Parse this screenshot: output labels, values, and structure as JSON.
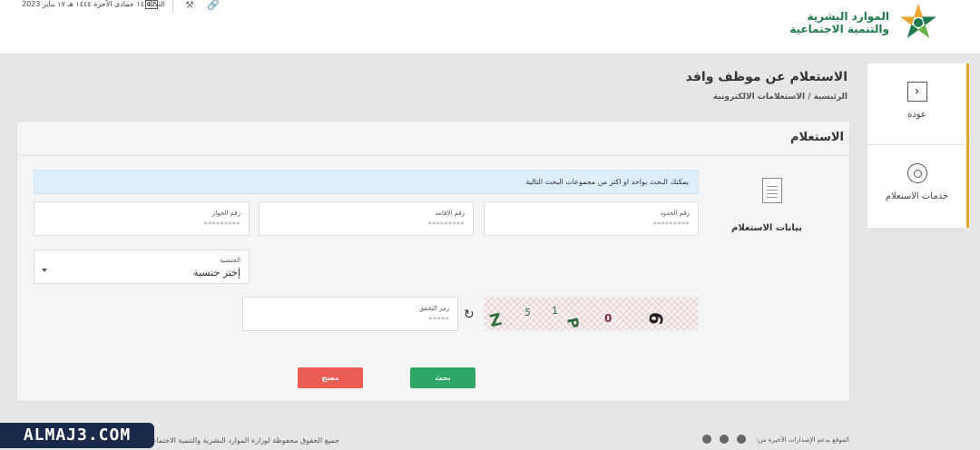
{
  "header": {
    "logo_line1": "الموارد البشرية",
    "logo_line2": "والتنمية الاجتماعية",
    "date": "الثلاثاء ١٤ جمادى الآخرة ١٤٤٤ هـ ١٧ يناير 2023",
    "calendar_day": "17",
    "colors": {
      "brand_green": "#1f7a4d",
      "brand_gold": "#e9a531"
    }
  },
  "sidenav": {
    "back_label": "عودة",
    "services_label": "خدمات الاستعلام"
  },
  "page": {
    "title": "الاستعلام عن موظف وافد",
    "breadcrumb": "الرئيسية / الاستعلامات الالكترونية"
  },
  "panel": {
    "title": "الاستعلام",
    "section_label": "بيانات الاستعلام",
    "info_text": "يمكنك البحث بواحد او اكثر من مجموعات البحث التالية",
    "fields": {
      "border_number": {
        "label": "رقم الحدود",
        "value": "*********"
      },
      "iqama_number": {
        "label": "رقم الإقامة",
        "value": "*********"
      },
      "passport_number": {
        "label": "رقم الجواز",
        "value": "*********"
      }
    },
    "nationality": {
      "label": "الجنسية",
      "value": "إختر جنسية"
    },
    "captcha_code": {
      "label": "رمز التحقق",
      "value": "*****"
    },
    "captcha_chars": [
      "Z",
      "5",
      "1",
      "P",
      "0",
      "9"
    ],
    "search_button": "بحث",
    "clear_button": "مسح"
  },
  "footer": {
    "copyright": "جميع الحقوق محفوظة لوزارة الموارد البشرية والتنمية الاجتماعية",
    "browsers_text": "الموقع يدعم الإصدارات الأخيرة من:",
    "watermark": "ALMAJ3.COM"
  }
}
